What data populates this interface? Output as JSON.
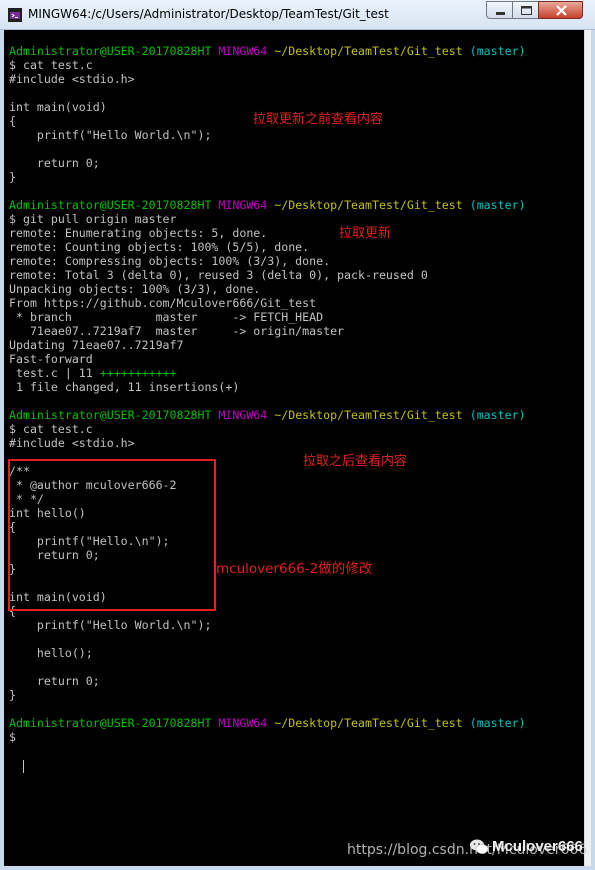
{
  "window": {
    "title": "MINGW64:/c/Users/Administrator/Desktop/TeamTest/Git_test"
  },
  "terminal": {
    "lines": [
      [
        {
          "t": "Administrator@USER-20170828HT",
          "c": "g"
        },
        {
          "t": " ",
          "c": "w"
        },
        {
          "t": "MINGW64",
          "c": "m"
        },
        {
          "t": " ",
          "c": "w"
        },
        {
          "t": "~/Desktop/TeamTest/Git_test",
          "c": "y"
        },
        {
          "t": " ",
          "c": "w"
        },
        {
          "t": "(master)",
          "c": "c"
        }
      ],
      [
        {
          "t": "$ cat test.c",
          "c": "w"
        }
      ],
      [
        {
          "t": "#include <stdio.h>",
          "c": "w"
        }
      ],
      [],
      [
        {
          "t": "int main(void)",
          "c": "w"
        }
      ],
      [
        {
          "t": "{",
          "c": "w"
        }
      ],
      [
        {
          "t": "    printf(\"Hello World.\\n\");",
          "c": "w"
        }
      ],
      [],
      [
        {
          "t": "    return 0;",
          "c": "w"
        }
      ],
      [
        {
          "t": "}",
          "c": "w"
        }
      ],
      [],
      [
        {
          "t": "Administrator@USER-20170828HT",
          "c": "g"
        },
        {
          "t": " ",
          "c": "w"
        },
        {
          "t": "MINGW64",
          "c": "m"
        },
        {
          "t": " ",
          "c": "w"
        },
        {
          "t": "~/Desktop/TeamTest/Git_test",
          "c": "y"
        },
        {
          "t": " ",
          "c": "w"
        },
        {
          "t": "(master)",
          "c": "c"
        }
      ],
      [
        {
          "t": "$ git pull origin master",
          "c": "w"
        }
      ],
      [
        {
          "t": "remote: Enumerating objects: 5, done.",
          "c": "w"
        }
      ],
      [
        {
          "t": "remote: Counting objects: 100% (5/5), done.",
          "c": "w"
        }
      ],
      [
        {
          "t": "remote: Compressing objects: 100% (3/3), done.",
          "c": "w"
        }
      ],
      [
        {
          "t": "remote: Total 3 (delta 0), reused 3 (delta 0), pack-reused 0",
          "c": "w"
        }
      ],
      [
        {
          "t": "Unpacking objects: 100% (3/3), done.",
          "c": "w"
        }
      ],
      [
        {
          "t": "From https://github.com/Mculover666/Git_test",
          "c": "w"
        }
      ],
      [
        {
          "t": " * branch            master     -> FETCH_HEAD",
          "c": "w"
        }
      ],
      [
        {
          "t": "   71eae07..7219af7  master     -> origin/master",
          "c": "w"
        }
      ],
      [
        {
          "t": "Updating 71eae07..7219af7",
          "c": "w"
        }
      ],
      [
        {
          "t": "Fast-forward",
          "c": "w"
        }
      ],
      [
        {
          "t": " test.c | 11 ",
          "c": "w"
        },
        {
          "t": "+++++++++++",
          "c": "g"
        }
      ],
      [
        {
          "t": " 1 file changed, 11 insertions(+)",
          "c": "w"
        }
      ],
      [],
      [
        {
          "t": "Administrator@USER-20170828HT",
          "c": "g"
        },
        {
          "t": " ",
          "c": "w"
        },
        {
          "t": "MINGW64",
          "c": "m"
        },
        {
          "t": " ",
          "c": "w"
        },
        {
          "t": "~/Desktop/TeamTest/Git_test",
          "c": "y"
        },
        {
          "t": " ",
          "c": "w"
        },
        {
          "t": "(master)",
          "c": "c"
        }
      ],
      [
        {
          "t": "$ cat test.c",
          "c": "w"
        }
      ],
      [
        {
          "t": "#include <stdio.h>",
          "c": "w"
        }
      ],
      [],
      [
        {
          "t": "/**",
          "c": "w"
        }
      ],
      [
        {
          "t": " * @author mculover666-2",
          "c": "w"
        }
      ],
      [
        {
          "t": " * */",
          "c": "w"
        }
      ],
      [
        {
          "t": "int hello()",
          "c": "w"
        }
      ],
      [
        {
          "t": "{",
          "c": "w"
        }
      ],
      [
        {
          "t": "    printf(\"Hello.\\n\");",
          "c": "w"
        }
      ],
      [
        {
          "t": "    return 0;",
          "c": "w"
        }
      ],
      [
        {
          "t": "}",
          "c": "w"
        }
      ],
      [],
      [
        {
          "t": "int main(void)",
          "c": "w"
        }
      ],
      [
        {
          "t": "{",
          "c": "w"
        }
      ],
      [
        {
          "t": "    printf(\"Hello World.\\n\");",
          "c": "w"
        }
      ],
      [],
      [
        {
          "t": "    hello();",
          "c": "w"
        }
      ],
      [],
      [
        {
          "t": "    return 0;",
          "c": "w"
        }
      ],
      [
        {
          "t": "}",
          "c": "w"
        }
      ],
      [],
      [
        {
          "t": "Administrator@USER-20170828HT",
          "c": "g"
        },
        {
          "t": " ",
          "c": "w"
        },
        {
          "t": "MINGW64",
          "c": "m"
        },
        {
          "t": " ",
          "c": "w"
        },
        {
          "t": "~/Desktop/TeamTest/Git_test",
          "c": "y"
        },
        {
          "t": " ",
          "c": "w"
        },
        {
          "t": "(master)",
          "c": "c"
        }
      ],
      [
        {
          "t": "$ ",
          "c": "w"
        }
      ]
    ]
  },
  "annotations": {
    "before_pull": "拉取更新之前查看内容",
    "pull": "拉取更新",
    "after_pull": "拉取之后查看内容",
    "modification": "mculover666-2做的修改"
  },
  "watermark": {
    "url": "https://blog.csdn.net/Mculover666",
    "author": "Mculover666"
  },
  "colors": {
    "user_host": "#00c000",
    "mingw": "#c000c0",
    "path": "#c0c000",
    "branch": "#00c0c0",
    "text": "#c0c0c0",
    "annotation": "#e02020"
  },
  "icons": [
    "git-bash-icon",
    "minimize-icon",
    "maximize-icon",
    "close-icon",
    "wechat-icon"
  ]
}
